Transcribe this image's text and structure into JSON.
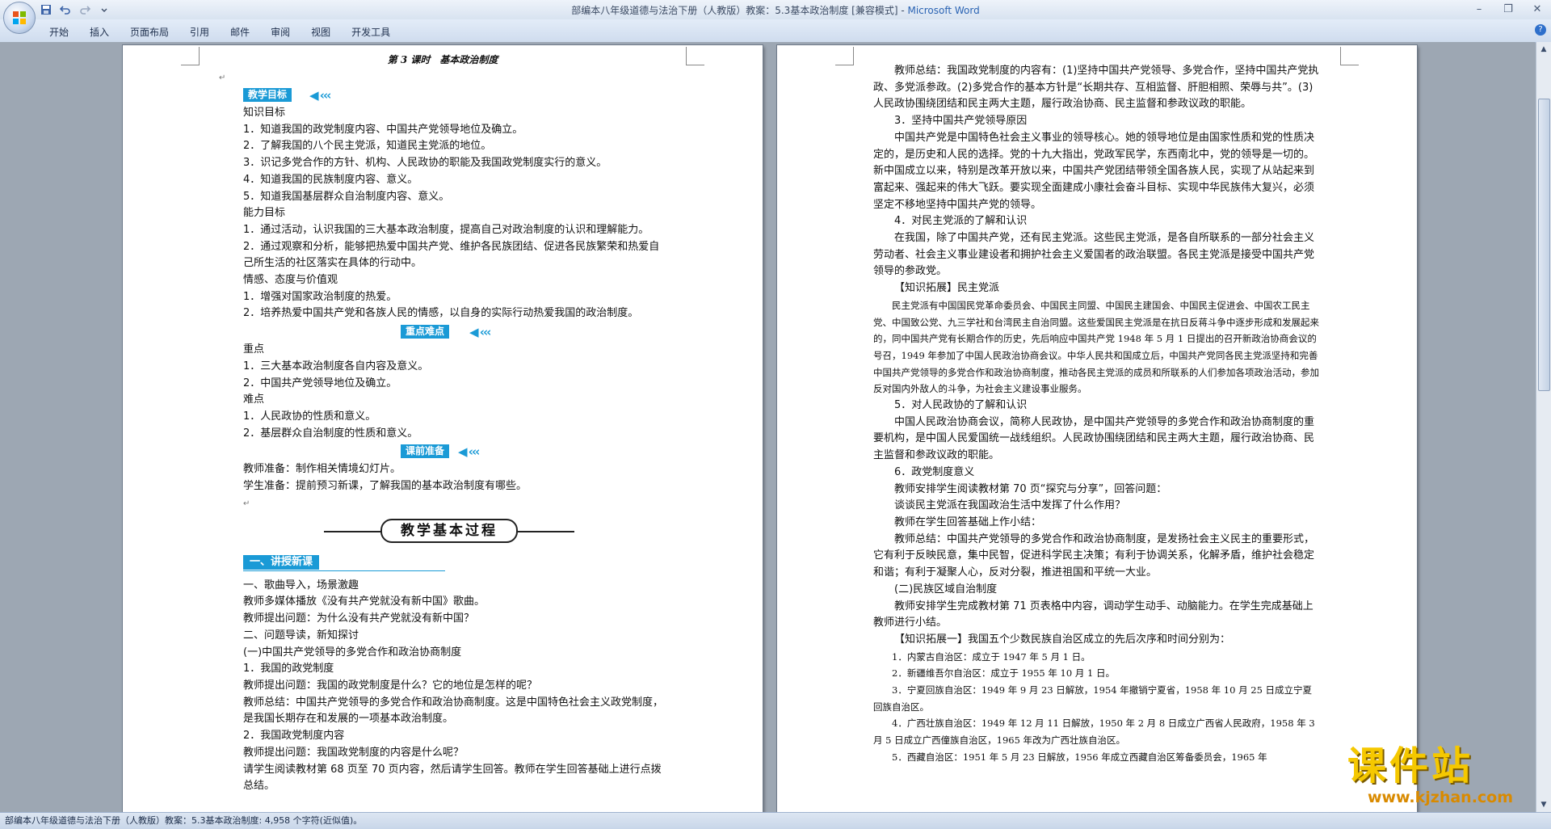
{
  "window": {
    "title": "部编本八年级道德与法治下册（人教版）教案：5.3基本政治制度 [兼容模式] - ",
    "app_name": "Microsoft Word",
    "help_label": "?"
  },
  "ribbon": {
    "tabs": [
      "开始",
      "插入",
      "页面布局",
      "引用",
      "邮件",
      "审阅",
      "视图",
      "开发工具"
    ]
  },
  "left_page": {
    "header": "第 3 课时　基本政治制度",
    "teaching_goals_label": "教学目标",
    "block1": [
      "知识目标",
      "1．知道我国的政党制度内容、中国共产党领导地位及确立。",
      "2．了解我国的八个民主党派，知道民主党派的地位。",
      "3．识记多党合作的方针、机构、人民政协的职能及我国政党制度实行的意义。",
      "4．知道我国的民族制度内容、意义。",
      "5．知道我国基层群众自治制度内容、意义。",
      "能力目标",
      "1．通过活动，认识我国的三大基本政治制度，提高自己对政治制度的认识和理解能力。",
      "2．通过观察和分析，能够把热爱中国共产党、维护各民族团结、促进各民族繁荣和热爱自己所生活的社区落实在具体的行动中。",
      "情感、态度与价值观",
      "1．增强对国家政治制度的热爱。",
      "2．培养热爱中国共产党和各族人民的情感，以自身的实际行动热爱我国的政治制度。"
    ],
    "key_points_label": "重点难点",
    "block2": [
      "重点",
      "1．三大基本政治制度各自内容及意义。",
      "2．中国共产党领导地位及确立。",
      "难点",
      "1．人民政协的性质和意义。",
      "2．基层群众自治制度的性质和意义。"
    ],
    "prep_label": "课前准备",
    "block3": [
      "教师准备：制作相关情境幻灯片。",
      "学生准备：提前预习新课，了解我国的基本政治制度有哪些。"
    ],
    "process_title": "教学基本过程",
    "lecture_label": "一、讲授新课",
    "block4": [
      "一、歌曲导入，场景激趣",
      "教师多媒体播放《没有共产党就没有新中国》歌曲。",
      "教师提出问题：为什么没有共产党就没有新中国？",
      "二、问题导读，新知探讨",
      "(一)中国共产党领导的多党合作和政治协商制度",
      "1．我国的政党制度",
      "教师提出问题：我国的政党制度是什么？它的地位是怎样的呢？",
      "教师总结：中国共产党领导的多党合作和政治协商制度。这是中国特色社会主义政党制度，是我国长期存在和发展的一项基本政治制度。",
      "2．我国政党制度内容",
      "教师提出问题：我国政党制度的内容是什么呢？",
      "请学生阅读教材第 68 页至 70 页内容，然后请学生回答。教师在学生回答基础上进行点拨总结。"
    ]
  },
  "right_page": {
    "paras": [
      {
        "t": "教师总结：我国政党制度的内容有：(1)坚持中国共产党领导、多党合作，坚持中国共产党执政、多党派参政。(2)多党合作的基本方针是“长期共存、互相监督、肝胆相照、荣辱与共”。(3)人民政协围绕团结和民主两大主题，履行政治协商、民主监督和参政议政的职能。",
        "s": "pi"
      },
      {
        "t": "3．坚持中国共产党领导原因",
        "s": "pi"
      },
      {
        "t": "中国共产党是中国特色社会主义事业的领导核心。她的领导地位是由国家性质和党的性质决定的，是历史和人民的选择。党的十九大指出，党政军民学，东西南北中，党的领导是一切的。新中国成立以来，特别是改革开放以来，中国共产党团结带领全国各族人民，实现了从站起来到富起来、强起来的伟大飞跃。要实现全面建成小康社会奋斗目标、实现中华民族伟大复兴，必须坚定不移地坚持中国共产党的领导。",
        "s": "pi"
      },
      {
        "t": "4．对民主党派的了解和认识",
        "s": "pi"
      },
      {
        "t": "在我国，除了中国共产党，还有民主党派。这些民主党派，是各自所联系的一部分社会主义劳动者、社会主义事业建设者和拥护社会主义爱国者的政治联盟。各民主党派是接受中国共产党领导的参政党。",
        "s": "pi"
      },
      {
        "t": "【知识拓展】民主党派",
        "s": "pi"
      },
      {
        "t": "民主党派有中国国民党革命委员会、中国民主同盟、中国民主建国会、中国民主促进会、中国农工民主党、中国致公党、九三学社和台湾民主自治同盟。这些爱国民主党派是在抗日反蒋斗争中逐步形成和发展起来的，同中国共产党有长期合作的历史，先后响应中国共产党 1948 年 5 月 1 日提出的召开新政治协商会议的号召，1949 年参加了中国人民政治协商会议。中华人民共和国成立后，中国共产党同各民主党派坚持和完善中国共产党领导的多党合作和政治协商制度，推动各民主党派的成员和所联系的人们参加各项政治活动，参加反对国内外敌人的斗争，为社会主义建设事业服务。",
        "s": "pi small"
      },
      {
        "t": "5．对人民政协的了解和认识",
        "s": "pi"
      },
      {
        "t": "中国人民政治协商会议，简称人民政协，是中国共产党领导的多党合作和政治协商制度的重要机构，是中国人民爱国统一战线组织。人民政协围绕团结和民主两大主题，履行政治协商、民主监督和参政议政的职能。",
        "s": "pi"
      },
      {
        "t": "6．政党制度意义",
        "s": "pi"
      },
      {
        "t": "教师安排学生阅读教材第 70 页“探究与分享”，回答问题：",
        "s": "pi"
      },
      {
        "t": "谈谈民主党派在我国政治生活中发挥了什么作用？",
        "s": "pi"
      },
      {
        "t": "教师在学生回答基础上作小结：",
        "s": "pi"
      },
      {
        "t": "教师总结：中国共产党领导的多党合作和政治协商制度，是发扬社会主义民主的重要形式，它有利于反映民意，集中民智，促进科学民主决策；有利于协调关系，化解矛盾，维护社会稳定和谐；有利于凝聚人心，反对分裂，推进祖国和平统一大业。",
        "s": "pi"
      },
      {
        "t": "(二)民族区域自治制度",
        "s": "pi"
      },
      {
        "t": "教师安排学生完成教材第 71 页表格中内容，调动学生动手、动脑能力。在学生完成基础上教师进行小结。",
        "s": "pi"
      },
      {
        "t": "【知识拓展一】我国五个少数民族自治区成立的先后次序和时间分别为：",
        "s": "pi"
      },
      {
        "t": "1．内蒙古自治区：成立于 1947 年 5 月 1 日。",
        "s": "pi small"
      },
      {
        "t": "2．新疆维吾尔自治区：成立于 1955 年 10 月 1 日。",
        "s": "pi small"
      },
      {
        "t": "3．宁夏回族自治区：1949 年 9 月 23 日解放，1954 年撤销宁夏省，1958 年 10 月 25 日成立宁夏回族自治区。",
        "s": "pi small"
      },
      {
        "t": "4．广西壮族自治区：1949 年 12 月 11 日解放，1950 年 2 月 8 日成立广西省人民政府，1958 年 3 月 5 日成立广西僮族自治区，1965 年改为广西壮族自治区。",
        "s": "pi small"
      },
      {
        "t": "5．西藏自治区：1951 年 5 月 23 日解放，1956 年成立西藏自治区筹备委员会，1965 年",
        "s": "pi small"
      }
    ]
  },
  "statusbar": {
    "text": "部编本八年级道德与法治下册（人教版）教案：5.3基本政治制度: 4,958 个字符(近似值)。"
  },
  "watermark": {
    "title": "课件站",
    "url": "www.kjzhan.com"
  },
  "colors": {
    "accent_blue": "#1a9ad6",
    "title_blue": "#2a63b3"
  }
}
